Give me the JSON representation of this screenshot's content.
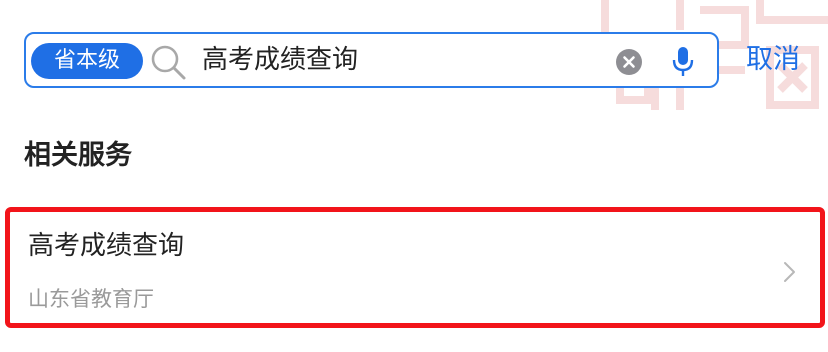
{
  "search": {
    "scope_label": "省本级",
    "query": "高考成绩查询",
    "search_icon": "search-icon",
    "clear_icon": "clear-icon",
    "mic_icon": "microphone-icon",
    "cancel_label": "取消"
  },
  "related_services": {
    "title": "相关服务",
    "items": [
      {
        "name": "高考成绩查询",
        "provider": "山东省教育厅",
        "icon": "chevron-right-icon",
        "highlighted": true
      }
    ]
  },
  "colors": {
    "accent": "#1f6fe5",
    "search_border": "#2b7ce9",
    "highlight_border": "#f2141a",
    "primary_text": "#222222",
    "secondary_text": "#9a9a9a",
    "decoration": "#f6dcdc"
  }
}
